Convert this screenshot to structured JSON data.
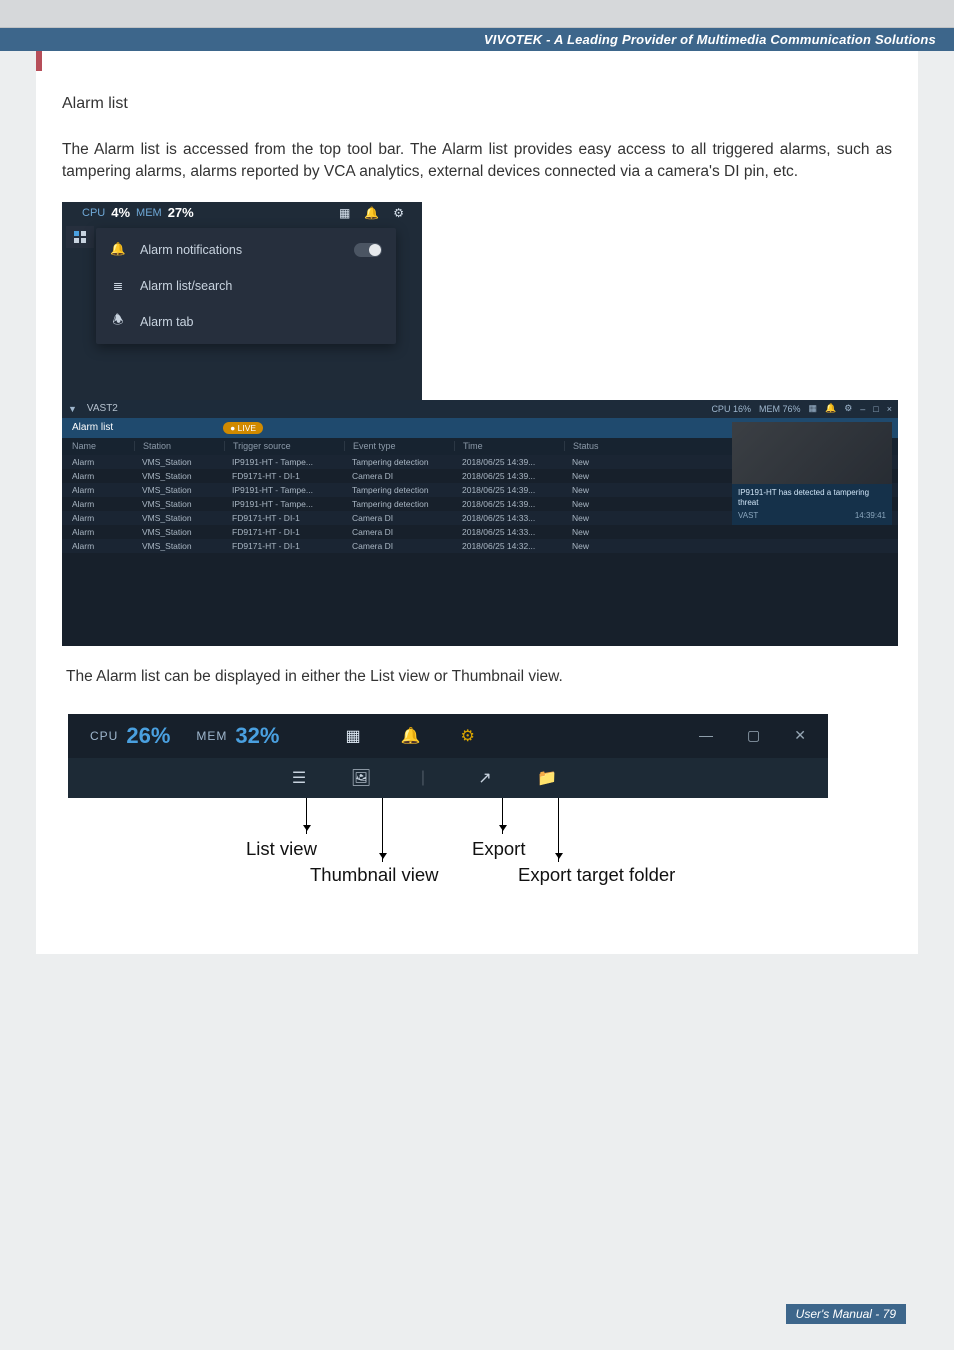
{
  "banner": "VIVOTEK - A Leading Provider of Multimedia Communication Solutions",
  "section_title": "Alarm list",
  "intro": "The Alarm list is accessed from the top tool bar. The Alarm list provides easy access to all triggered alarms, such as tampering alarms, alarms reported by VCA analytics, external devices connected via a camera's DI pin, etc.",
  "img1": {
    "cpu_label": "CPU",
    "cpu_pct": "4%",
    "mem_label": "MEM",
    "mem_pct": "27%",
    "rows": {
      "r1": "Alarm notifications",
      "r2": "Alarm list/search",
      "r3": "Alarm tab"
    }
  },
  "wide": {
    "app": "VAST2",
    "cpu": "CPU 16%",
    "mem": "MEM 76%",
    "tab": "Alarm list",
    "live": "LIVE",
    "cols": {
      "c1": "Name",
      "c2": "Station",
      "c3": "Trigger source",
      "c4": "Event type",
      "c5": "Time",
      "c6": "Status"
    },
    "rows": [
      {
        "c1": "Alarm",
        "c2": "VMS_Station",
        "c3": "IP9191-HT - Tampe...",
        "c4": "Tampering detection",
        "c5": "2018/06/25 14:39...",
        "c6": "New"
      },
      {
        "c1": "Alarm",
        "c2": "VMS_Station",
        "c3": "FD9171-HT - DI-1",
        "c4": "Camera DI",
        "c5": "2018/06/25 14:39...",
        "c6": "New"
      },
      {
        "c1": "Alarm",
        "c2": "VMS_Station",
        "c3": "IP9191-HT - Tampe...",
        "c4": "Tampering detection",
        "c5": "2018/06/25 14:39...",
        "c6": "New"
      },
      {
        "c1": "Alarm",
        "c2": "VMS_Station",
        "c3": "IP9191-HT - Tampe...",
        "c4": "Tampering detection",
        "c5": "2018/06/25 14:39...",
        "c6": "New"
      },
      {
        "c1": "Alarm",
        "c2": "VMS_Station",
        "c3": "FD9171-HT - DI-1",
        "c4": "Camera DI",
        "c5": "2018/06/25 14:33...",
        "c6": "New"
      },
      {
        "c1": "Alarm",
        "c2": "VMS_Station",
        "c3": "FD9171-HT - DI-1",
        "c4": "Camera DI",
        "c5": "2018/06/25 14:33...",
        "c6": "New"
      },
      {
        "c1": "Alarm",
        "c2": "VMS_Station",
        "c3": "FD9171-HT - DI-1",
        "c4": "Camera DI",
        "c5": "2018/06/25 14:32...",
        "c6": "New"
      }
    ],
    "preview": {
      "line1": "IP9191-HT has detected a tampering threat",
      "line2a": "VAST",
      "line2b": "14:39:41"
    }
  },
  "mid_caption": "The Alarm list can be displayed in either the List view or Thumbnail view.",
  "anno": {
    "cpu_label": "CPU",
    "cpu_pct": "26%",
    "mem_label": "MEM",
    "mem_pct": "32%",
    "l1": "List view",
    "l2": "Thumbnail view",
    "l3": "Export",
    "l4": "Export target folder"
  },
  "footer": "User's Manual - 79"
}
